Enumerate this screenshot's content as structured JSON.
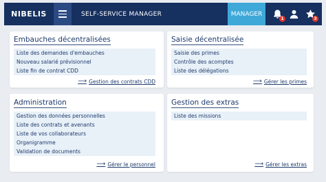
{
  "header": {
    "logo": "NIBELIS",
    "title": "SELF-SERVICE MANAGER",
    "manager_label": "MANAGER",
    "notifications_count": "1",
    "favorites_count": "3"
  },
  "panels": {
    "embauches": {
      "title": "Embauches décentralisées",
      "items": [
        "Liste des demandes d'embauches",
        "Nouveau salarié prévisionnel",
        "Liste fin de contrat CDD"
      ],
      "link": "Gestion des contrats CDD"
    },
    "saisie": {
      "title": "Saisie décentralisée",
      "items": [
        "Saisie des primes",
        "Contrôle des acomptes",
        "Liste des délégations"
      ],
      "link": "Gérer les primes"
    },
    "administration": {
      "title": "Administration",
      "items": [
        "Gestion des données personnelles",
        "Liste des contrats et avenants",
        "Liste de vos collaborateurs",
        "Organigramme",
        "Validation de documents"
      ],
      "link": "Gérer le personnel"
    },
    "extras": {
      "title": "Gestion des extras",
      "items": [
        "Liste des missions"
      ],
      "link": "Gérer les extras"
    }
  }
}
